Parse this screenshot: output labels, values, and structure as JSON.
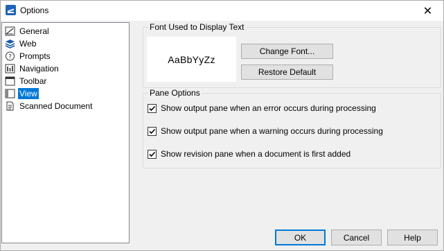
{
  "window": {
    "title": "Options",
    "close_glyph": "✕"
  },
  "tree": {
    "items": [
      {
        "label": "General",
        "icon": "general-icon"
      },
      {
        "label": "Web",
        "icon": "web-layers-icon"
      },
      {
        "label": "Prompts",
        "icon": "question-icon"
      },
      {
        "label": "Navigation",
        "icon": "navigation-icon"
      },
      {
        "label": "Toolbar",
        "icon": "toolbar-icon"
      },
      {
        "label": "View",
        "icon": "view-icon",
        "selected": true
      },
      {
        "label": "Scanned Document",
        "icon": "document-icon"
      }
    ]
  },
  "font_group": {
    "title": "Font Used to Display Text",
    "sample": "AaBbYyZz",
    "change_font_label": "Change Font...",
    "restore_default_label": "Restore Default"
  },
  "pane_group": {
    "title": "Pane Options",
    "options": [
      {
        "label": "Show output pane when an error occurs during processing",
        "checked": true
      },
      {
        "label": "Show output pane when a warning occurs during processing",
        "checked": true
      },
      {
        "label": "Show revision pane when a document is first added",
        "checked": true
      }
    ]
  },
  "footer": {
    "ok_label": "OK",
    "cancel_label": "Cancel",
    "help_label": "Help"
  },
  "colors": {
    "selection": "#0078d7",
    "dialog_bg": "#f0f0f0"
  }
}
